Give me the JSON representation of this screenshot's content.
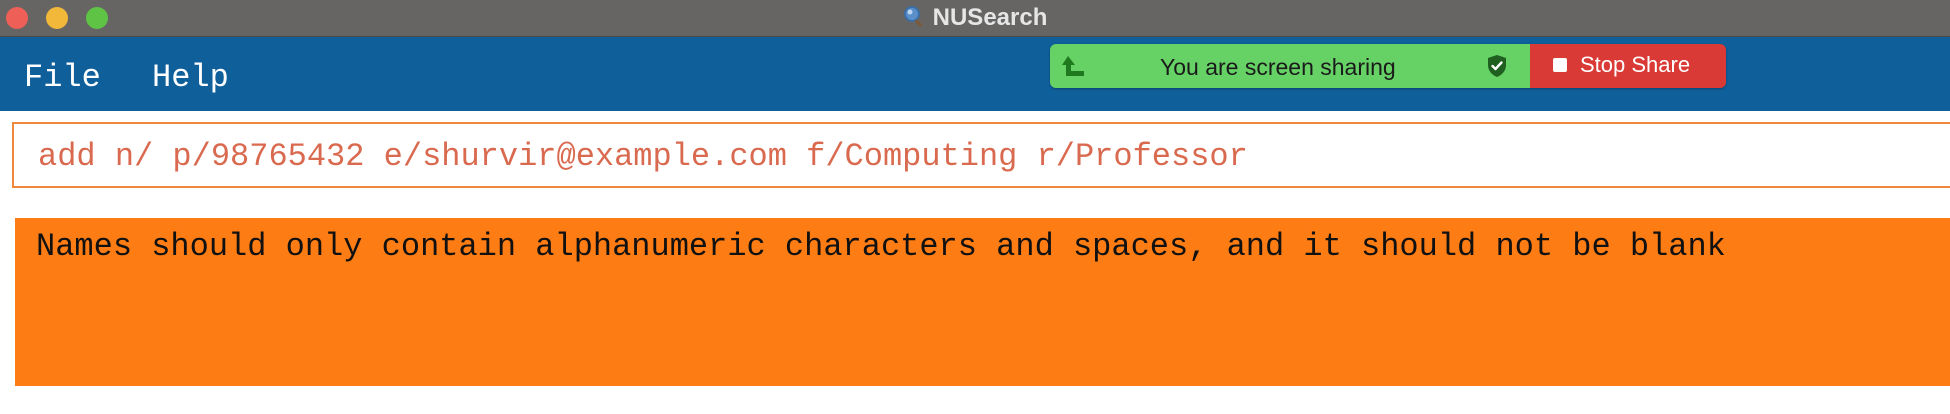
{
  "window": {
    "title": "NUSearch",
    "title_icon": "magnifier-icon"
  },
  "menu": {
    "items": [
      {
        "label": "File"
      },
      {
        "label": "Help"
      }
    ]
  },
  "screen_share": {
    "status_text": "You are screen sharing",
    "stop_label": "Stop Share",
    "colors": {
      "status_bg": "#66d266",
      "stop_bg": "#d93a36"
    }
  },
  "command_box": {
    "value": "add n/ p/98765432 e/shurvir@example.com f/Computing r/Professor"
  },
  "result_display": {
    "message": "Names should only contain alphanumeric characters and spaces, and it should not be blank"
  },
  "colors": {
    "menubar": "#0f5f9b",
    "titlebar": "#666564",
    "error_bg": "#fe7c14",
    "error_border": "#ef8a3c"
  }
}
